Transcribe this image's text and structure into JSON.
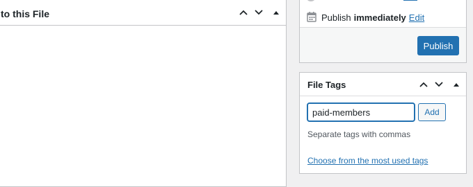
{
  "left_box": {
    "title": "to this File"
  },
  "publish": {
    "prefix": "Publish",
    "status": "immediately",
    "edit_link": "Edit",
    "button_label": "Publish"
  },
  "tags_box": {
    "title": "File Tags",
    "input_value": "paid-members",
    "add_label": "Add",
    "howto": "Separate tags with commas",
    "most_used_link": "Choose from the most used tags"
  },
  "icons": {
    "move_up": "chevron-up-icon",
    "move_down": "chevron-down-icon",
    "toggle": "caret-up-icon",
    "calendar": "calendar-icon"
  },
  "colors": {
    "accent": "#2271b1",
    "border": "#c3c4c7",
    "background": "#f0f0f1"
  }
}
